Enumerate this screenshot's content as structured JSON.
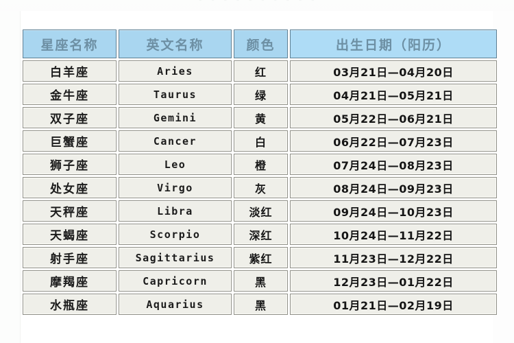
{
  "page": {
    "top_remnant_text": "▪ ▪ ▪ ▪ ▪      ▪ ▪        ▪ ▪ ▪",
    "colors": {
      "header_fill": "#a9d6f0",
      "header_fill_date": "#aedcf6",
      "header_text": "#6d8fa3",
      "cell_fill": "#efefe9",
      "cell_border": "#8e8e86",
      "body_text": "#1b1b1b",
      "page_background": "#ffffff"
    }
  },
  "table": {
    "headers": {
      "name": "星座名称",
      "english": "英文名称",
      "color": "颜色",
      "birthdate": "出生日期（阳历）"
    },
    "rows": [
      {
        "name": "白羊座",
        "english": "Aries",
        "color": "红",
        "birthdate": "03月21日—04月20日"
      },
      {
        "name": "金牛座",
        "english": "Taurus",
        "color": "绿",
        "birthdate": "04月21日—05月21日"
      },
      {
        "name": "双子座",
        "english": "Gemini",
        "color": "黄",
        "birthdate": "05月22日—06月21日"
      },
      {
        "name": "巨蟹座",
        "english": "Cancer",
        "color": "白",
        "birthdate": "06月22日—07月23日"
      },
      {
        "name": "狮子座",
        "english": "Leo",
        "color": "橙",
        "birthdate": "07月24日—08月23日"
      },
      {
        "name": "处女座",
        "english": "Virgo",
        "color": "灰",
        "birthdate": "08月24日—09月23日"
      },
      {
        "name": "天秤座",
        "english": "Libra",
        "color": "淡红",
        "birthdate": "09月24日—10月23日"
      },
      {
        "name": "天蝎座",
        "english": "Scorpio",
        "color": "深红",
        "birthdate": "10月24日—11月22日"
      },
      {
        "name": "射手座",
        "english": "Sagittarius",
        "color": "紫红",
        "birthdate": "11月23日—12月22日"
      },
      {
        "name": "摩羯座",
        "english": "Capricorn",
        "color": "黑",
        "birthdate": "12月23日—01月22日"
      },
      {
        "name": "水瓶座",
        "english": "Aquarius",
        "color": "黑",
        "birthdate": "01月21日—02月19日"
      }
    ]
  }
}
